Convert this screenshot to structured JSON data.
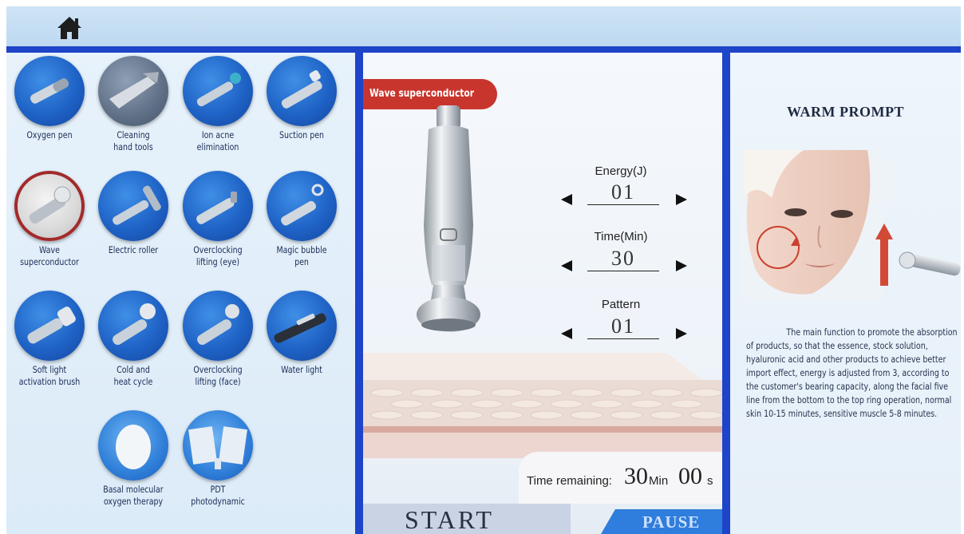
{
  "header": {
    "home_icon": "home-icon"
  },
  "tools": [
    {
      "label": "Oxygen pen"
    },
    {
      "label": "Cleaning\nhand tools"
    },
    {
      "label": "Ion acne\nelimination"
    },
    {
      "label": "Suction pen"
    },
    {
      "label": "Wave\nsuperconductor",
      "selected": true
    },
    {
      "label": "Electric roller"
    },
    {
      "label": "Overclocking\nlifting (eye)"
    },
    {
      "label": "Magic bubble\npen"
    },
    {
      "label": "Soft light\nactivation brush"
    },
    {
      "label": "Cold and\nheat cycle"
    },
    {
      "label": "Overclocking\nlifting (face)"
    },
    {
      "label": "Water light"
    },
    {
      "label": "Basal molecular\noxygen therapy"
    },
    {
      "label": "PDT\nphotodynamic"
    }
  ],
  "mode": {
    "title": "Wave superconductor"
  },
  "controls": {
    "energy": {
      "label": "Energy(J)",
      "value": "01"
    },
    "time": {
      "label": "Time(Min)",
      "value": "30"
    },
    "pattern": {
      "label": "Pattern",
      "value": "01"
    }
  },
  "timer": {
    "label": "Time remaining:",
    "minutes": "30",
    "min_unit": "Min",
    "seconds": "00",
    "sec_unit": "s"
  },
  "buttons": {
    "start": "START",
    "pause": "PAUSE"
  },
  "prompt": {
    "title": "WARM PROMPT",
    "text": "The main function to promote the absorption of products, so that the essence, stock solution, hyaluronic acid and other products to achieve better import effect, energy is adjusted from 3, according to the customer's bearing capacity, along the facial five line from the bottom to the top ring operation, normal skin 10-15 minutes, sensitive muscle 5-8 minutes."
  },
  "colors": {
    "accent_blue": "#1d44c9",
    "badge_red": "#c8352d",
    "pause_blue": "#2f7ddc"
  }
}
